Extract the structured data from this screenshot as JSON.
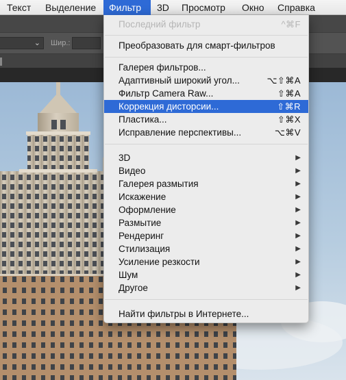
{
  "menubar": {
    "items": [
      {
        "label": "Текст"
      },
      {
        "label": "Выделение"
      },
      {
        "label": "Фильтр"
      },
      {
        "label": "3D"
      },
      {
        "label": "Просмотр"
      },
      {
        "label": "Окно"
      },
      {
        "label": "Справка"
      }
    ],
    "active": "Фильтр"
  },
  "options_bar": {
    "width_label": "Шир.:",
    "tool_select_icon": "chevron-down-icon"
  },
  "filter_menu": {
    "last_filter": {
      "label": "Последний фильтр",
      "shortcut": "^⌘F",
      "enabled": false
    },
    "convert_smart": {
      "label": "Преобразовать для смарт-фильтров"
    },
    "gallery": {
      "label": "Галерея фильтров..."
    },
    "adaptive_wide": {
      "label": "Адаптивный широкий угол...",
      "shortcut": "⌥⇧⌘A"
    },
    "camera_raw": {
      "label": "Фильтр Camera Raw...",
      "shortcut": "⇧⌘A"
    },
    "lens_correction": {
      "label": "Коррекция дисторсии...",
      "shortcut": "⇧⌘R",
      "highlighted": true
    },
    "liquify": {
      "label": "Пластика...",
      "shortcut": "⇧⌘X"
    },
    "vanishing_point": {
      "label": "Исправление перспективы...",
      "shortcut": "⌥⌘V"
    },
    "submenus": [
      {
        "label": "3D"
      },
      {
        "label": "Видео"
      },
      {
        "label": "Галерея размытия"
      },
      {
        "label": "Искажение"
      },
      {
        "label": "Оформление"
      },
      {
        "label": "Размытие"
      },
      {
        "label": "Рендеринг"
      },
      {
        "label": "Стилизация"
      },
      {
        "label": "Усиление резкости"
      },
      {
        "label": "Шум"
      },
      {
        "label": "Другое"
      }
    ],
    "browse_online": {
      "label": "Найти фильтры в Интернете..."
    },
    "submenu_arrow": "▶",
    "highlight_color": "#2e6ad6"
  }
}
